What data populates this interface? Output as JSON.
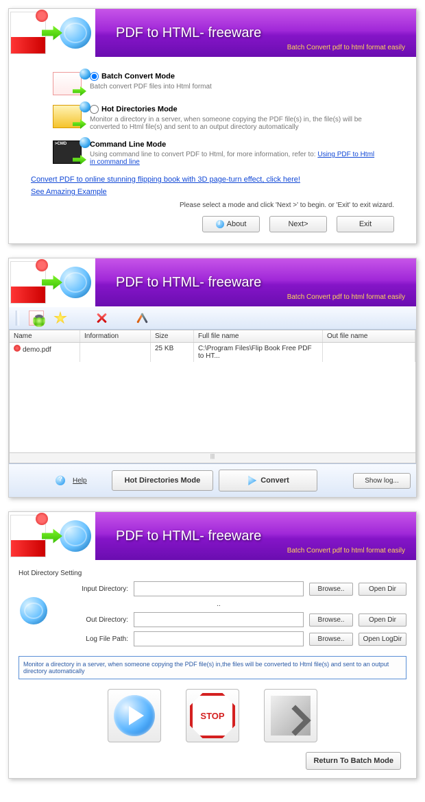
{
  "app": {
    "title": "PDF to HTML- freeware",
    "tagline": "Batch Convert  pdf to html format easily"
  },
  "w1": {
    "modes": [
      {
        "title": "Batch Convert Mode",
        "desc": "Batch convert PDF files into Html format",
        "checked": true
      },
      {
        "title": "Hot Directories Mode",
        "desc": "Monitor a directory in a server, when someone copying the PDF file(s) in, the file(s) will be converted to Html file(s) and sent to an output directory automatically",
        "checked": false
      },
      {
        "title": "Command Line Mode",
        "desc": "Using command line to convert PDF to Html, for more information, refer to:",
        "link": "Using PDF to Html in command line"
      }
    ],
    "promo1": "Convert PDF to online stunning flipping book with 3D page-turn effect, click here!",
    "promo2": "See Amazing Example ",
    "instr": "Please select a mode and click 'Next >' to begin. or 'Exit' to exit wizard.",
    "btn_about": "About",
    "btn_next": "Next>",
    "btn_exit": "Exit"
  },
  "w2": {
    "cols": {
      "name": "Name",
      "info": "Information",
      "size": "Size",
      "full": "Full file name",
      "out": "Out file name"
    },
    "rows": [
      {
        "name": "demo.pdf",
        "info": "",
        "size": "25 KB",
        "full": "C:\\Program Files\\Flip Book Free PDF to HT...",
        "out": ""
      }
    ],
    "help": "Help",
    "hot": "Hot Directories Mode",
    "convert": "Convert",
    "showlog": "Show log..."
  },
  "w3": {
    "section": "Hot Directory Setting",
    "lbl_in": "Input Directory:",
    "lbl_dots": "..",
    "lbl_out": "Out Directory:",
    "lbl_log": "Log File Path:",
    "browse": "Browse..",
    "opendir": "Open Dir",
    "openlog": "Open LogDir",
    "note": "Monitor a directory in a server, when someone copying the PDF file(s) in,the files will be converted to Html file(s) and sent to an output directory automatically",
    "stop": "STOP",
    "return": "Return To Batch Mode"
  }
}
